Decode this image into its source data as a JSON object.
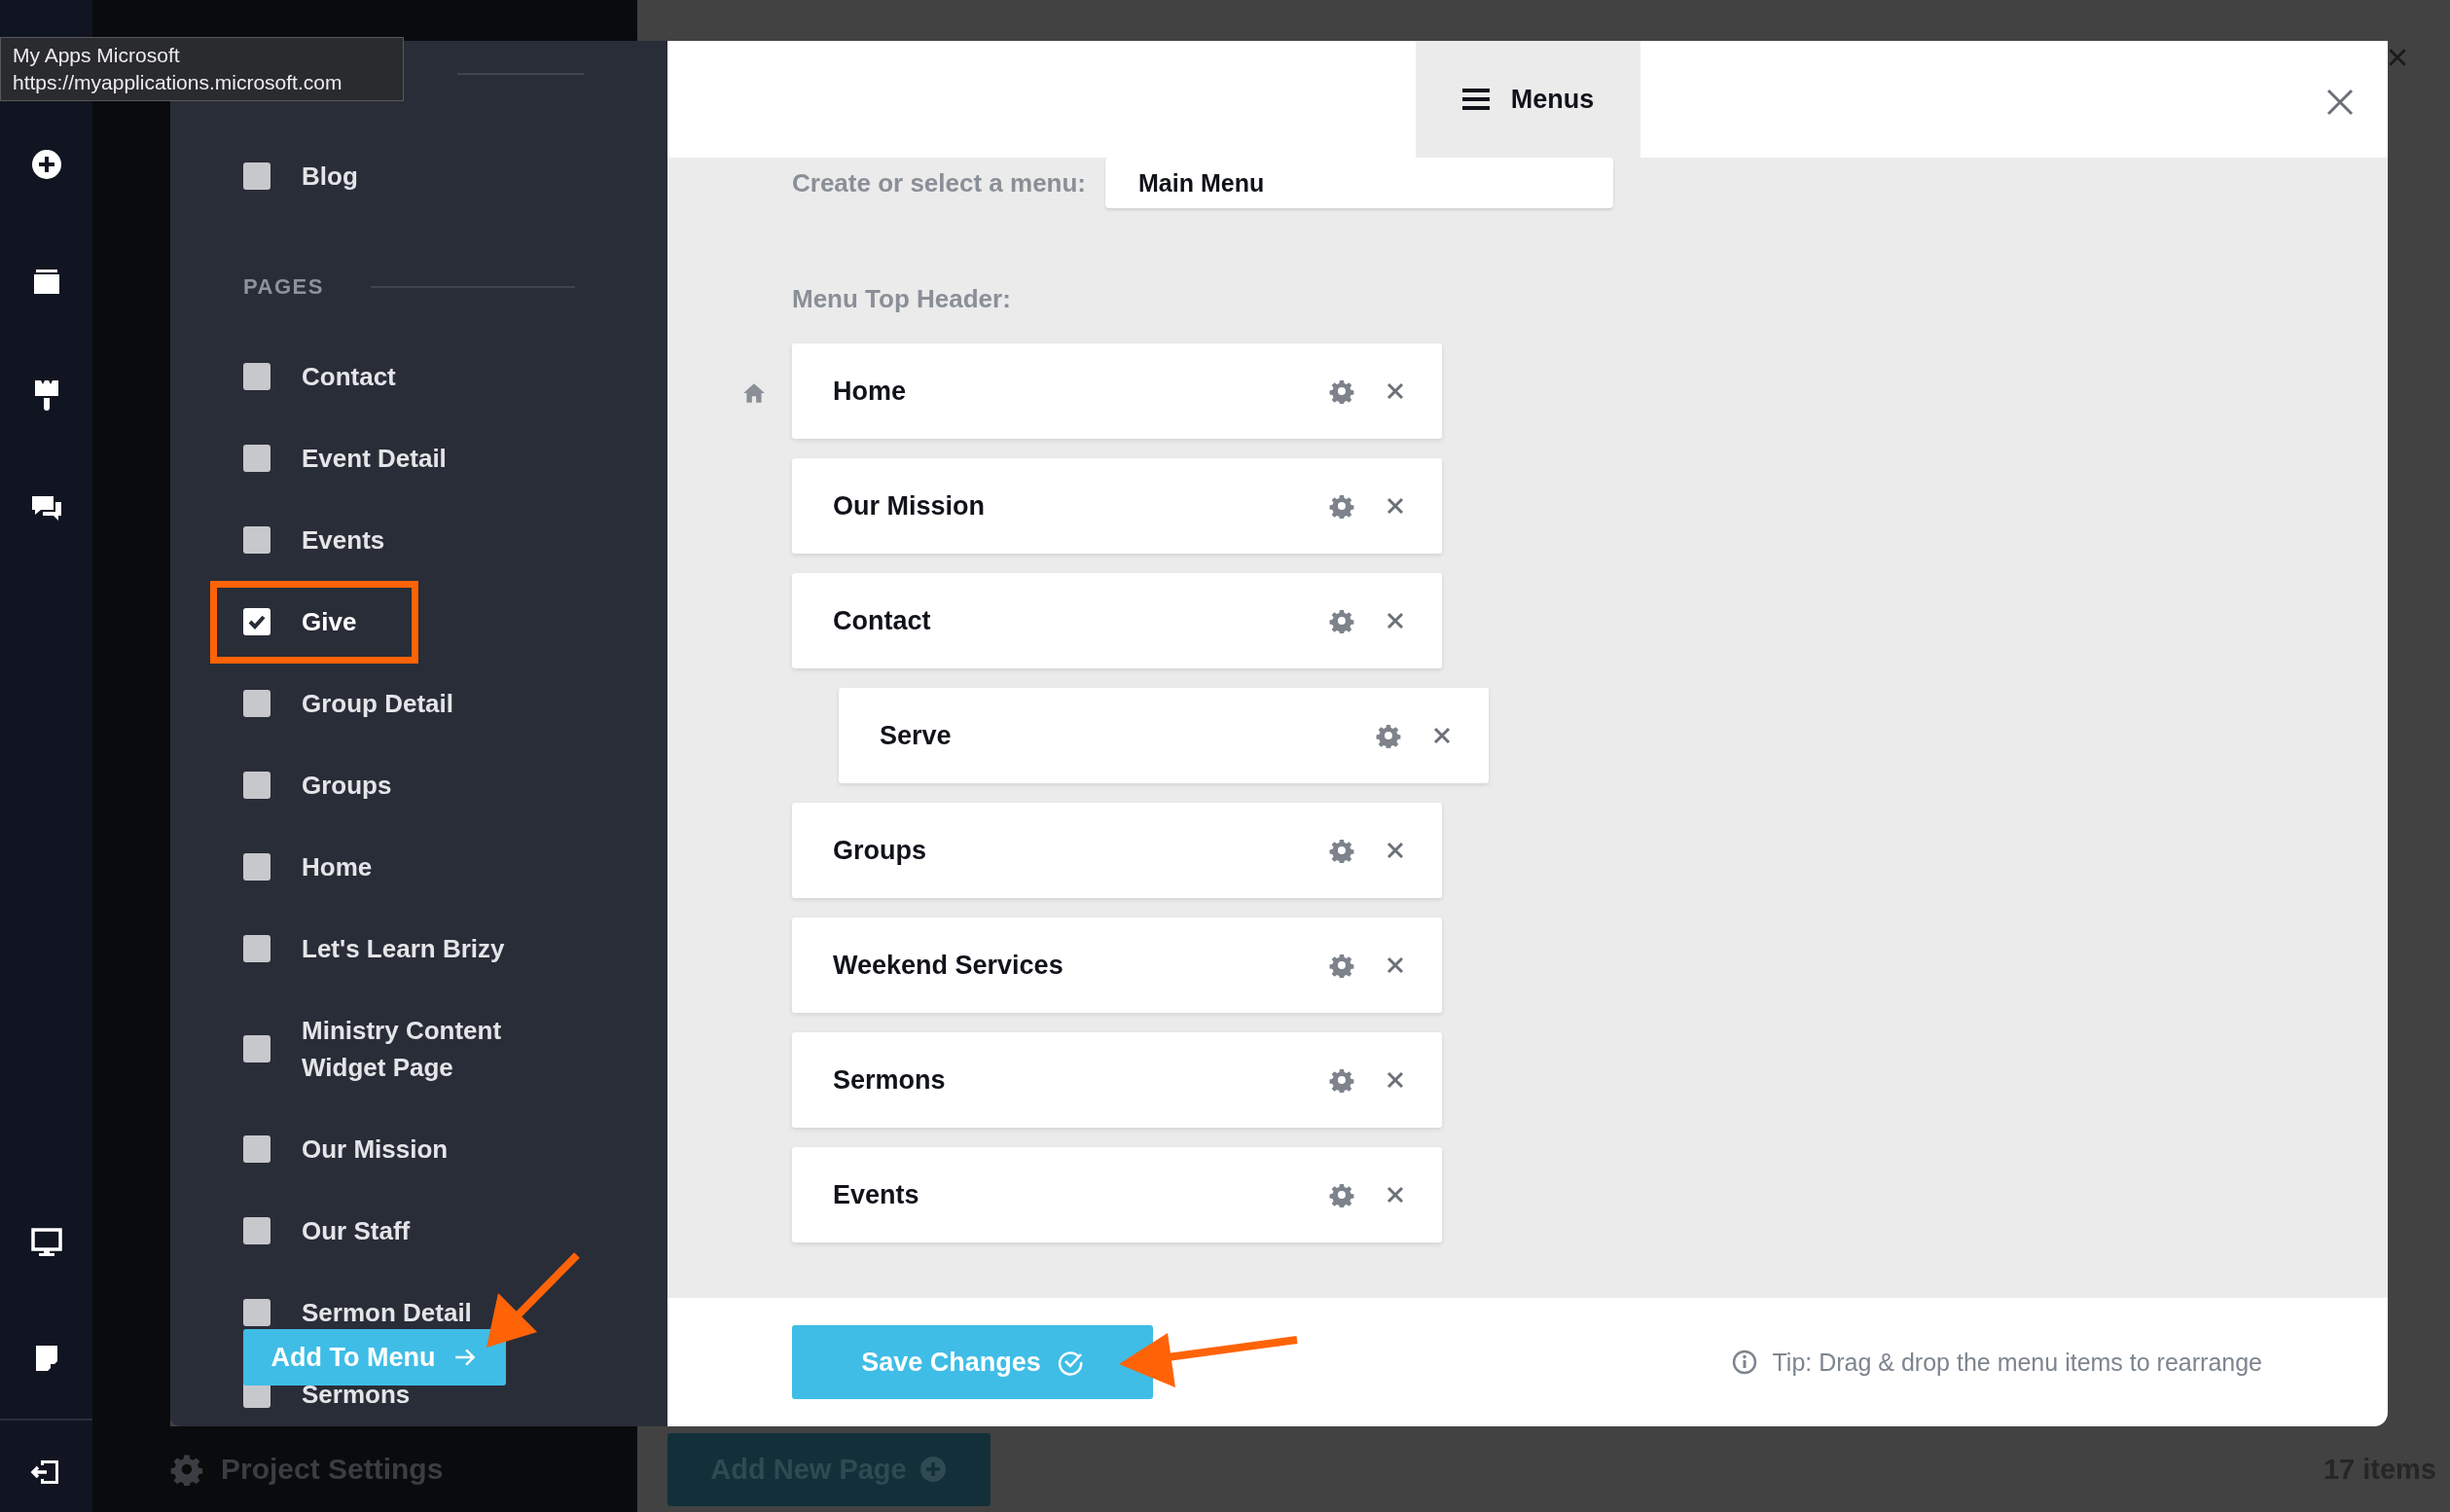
{
  "tooltip": {
    "title": "My Apps Microsoft",
    "url": "https://myapplications.microsoft.com"
  },
  "sidebar": {
    "sections": [
      {
        "items": [
          {
            "label": "Blog",
            "checked": false,
            "highlighted": false
          }
        ]
      },
      {
        "title": "PAGES",
        "items": [
          {
            "label": "Contact",
            "checked": false,
            "highlighted": false
          },
          {
            "label": "Event Detail",
            "checked": false,
            "highlighted": false
          },
          {
            "label": "Events",
            "checked": false,
            "highlighted": false
          },
          {
            "label": "Give",
            "checked": true,
            "highlighted": true
          },
          {
            "label": "Group Detail",
            "checked": false,
            "highlighted": false
          },
          {
            "label": "Groups",
            "checked": false,
            "highlighted": false
          },
          {
            "label": "Home",
            "checked": false,
            "highlighted": false
          },
          {
            "label": "Let's Learn Brizy",
            "checked": false,
            "highlighted": false
          },
          {
            "label": "Ministry Content Widget Page",
            "checked": false,
            "highlighted": false
          },
          {
            "label": "Our Mission",
            "checked": false,
            "highlighted": false
          },
          {
            "label": "Our Staff",
            "checked": false,
            "highlighted": false
          },
          {
            "label": "Sermon Detail",
            "checked": false,
            "highlighted": false
          },
          {
            "label": "Sermons",
            "checked": false,
            "highlighted": false
          }
        ]
      }
    ],
    "button": "Add To Menu"
  },
  "modal": {
    "tab": "Menus",
    "menu_picker": {
      "label": "Create or select a menu:",
      "value": "Main Menu"
    },
    "section_label": "Menu Top Header:",
    "menu_items": [
      {
        "label": "Home",
        "home": true
      },
      {
        "label": "Our Mission",
        "home": false
      },
      {
        "label": "Contact",
        "home": false,
        "children": [
          {
            "label": "Serve",
            "home": false
          }
        ]
      },
      {
        "label": "Groups",
        "home": false
      },
      {
        "label": "Weekend Services",
        "home": false
      },
      {
        "label": "Sermons",
        "home": false
      },
      {
        "label": "Events",
        "home": false
      }
    ],
    "save_button": "Save Changes",
    "tip": "Tip: Drag & drop the menu items to rearrange"
  },
  "background": {
    "project_settings": "Project Settings",
    "add_page_button": "Add New Page",
    "item_count": "17 items"
  }
}
